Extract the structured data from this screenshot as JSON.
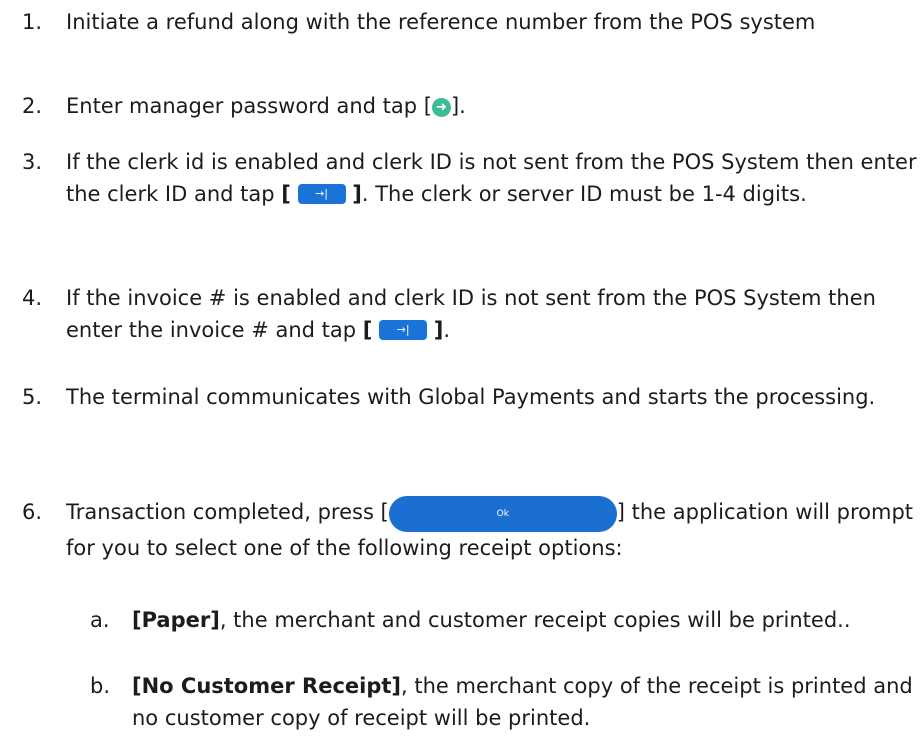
{
  "steps": [
    {
      "num": "1.",
      "text": "Initiate a refund along with the reference number from the POS system"
    },
    {
      "num": "2.",
      "pre": "Enter manager password and tap [",
      "post": "]."
    },
    {
      "num": "3.",
      "pre": "If the clerk id is enabled and clerk ID is not sent from the POS System then enter the clerk ID and tap ",
      "open": "[",
      "close": "]",
      "post": ". The clerk or server ID must be 1-4 digits."
    },
    {
      "num": "4.",
      "pre": "If the invoice # is enabled and clerk ID is not sent from the POS System then enter the invoice # and tap ",
      "open": "[",
      "close": "]",
      "post": "."
    },
    {
      "num": "5.",
      "text": "The terminal communicates with Global Payments and starts the processing."
    },
    {
      "num": "6.",
      "pre": "Transaction completed, press [",
      "button_label": "Ok",
      "post": "] the application will prompt for you to select one of the following receipt options:"
    }
  ],
  "substeps": [
    {
      "letter": "a.",
      "bold": "[Paper]",
      "text": ", the merchant and customer receipt copies will be printed.."
    },
    {
      "letter": "b.",
      "bold": "[No Customer Receipt]",
      "text": ", the merchant copy of the receipt is printed and no customer copy of receipt will be printed."
    }
  ],
  "icons": {
    "next_circle": "arrow-right-circle-icon",
    "tab_key": "tab-key-icon",
    "tab_glyph": "→|"
  },
  "colors": {
    "accent_green": "#3dbb95",
    "accent_blue": "#1a74d8",
    "text": "#1c1c1c"
  }
}
